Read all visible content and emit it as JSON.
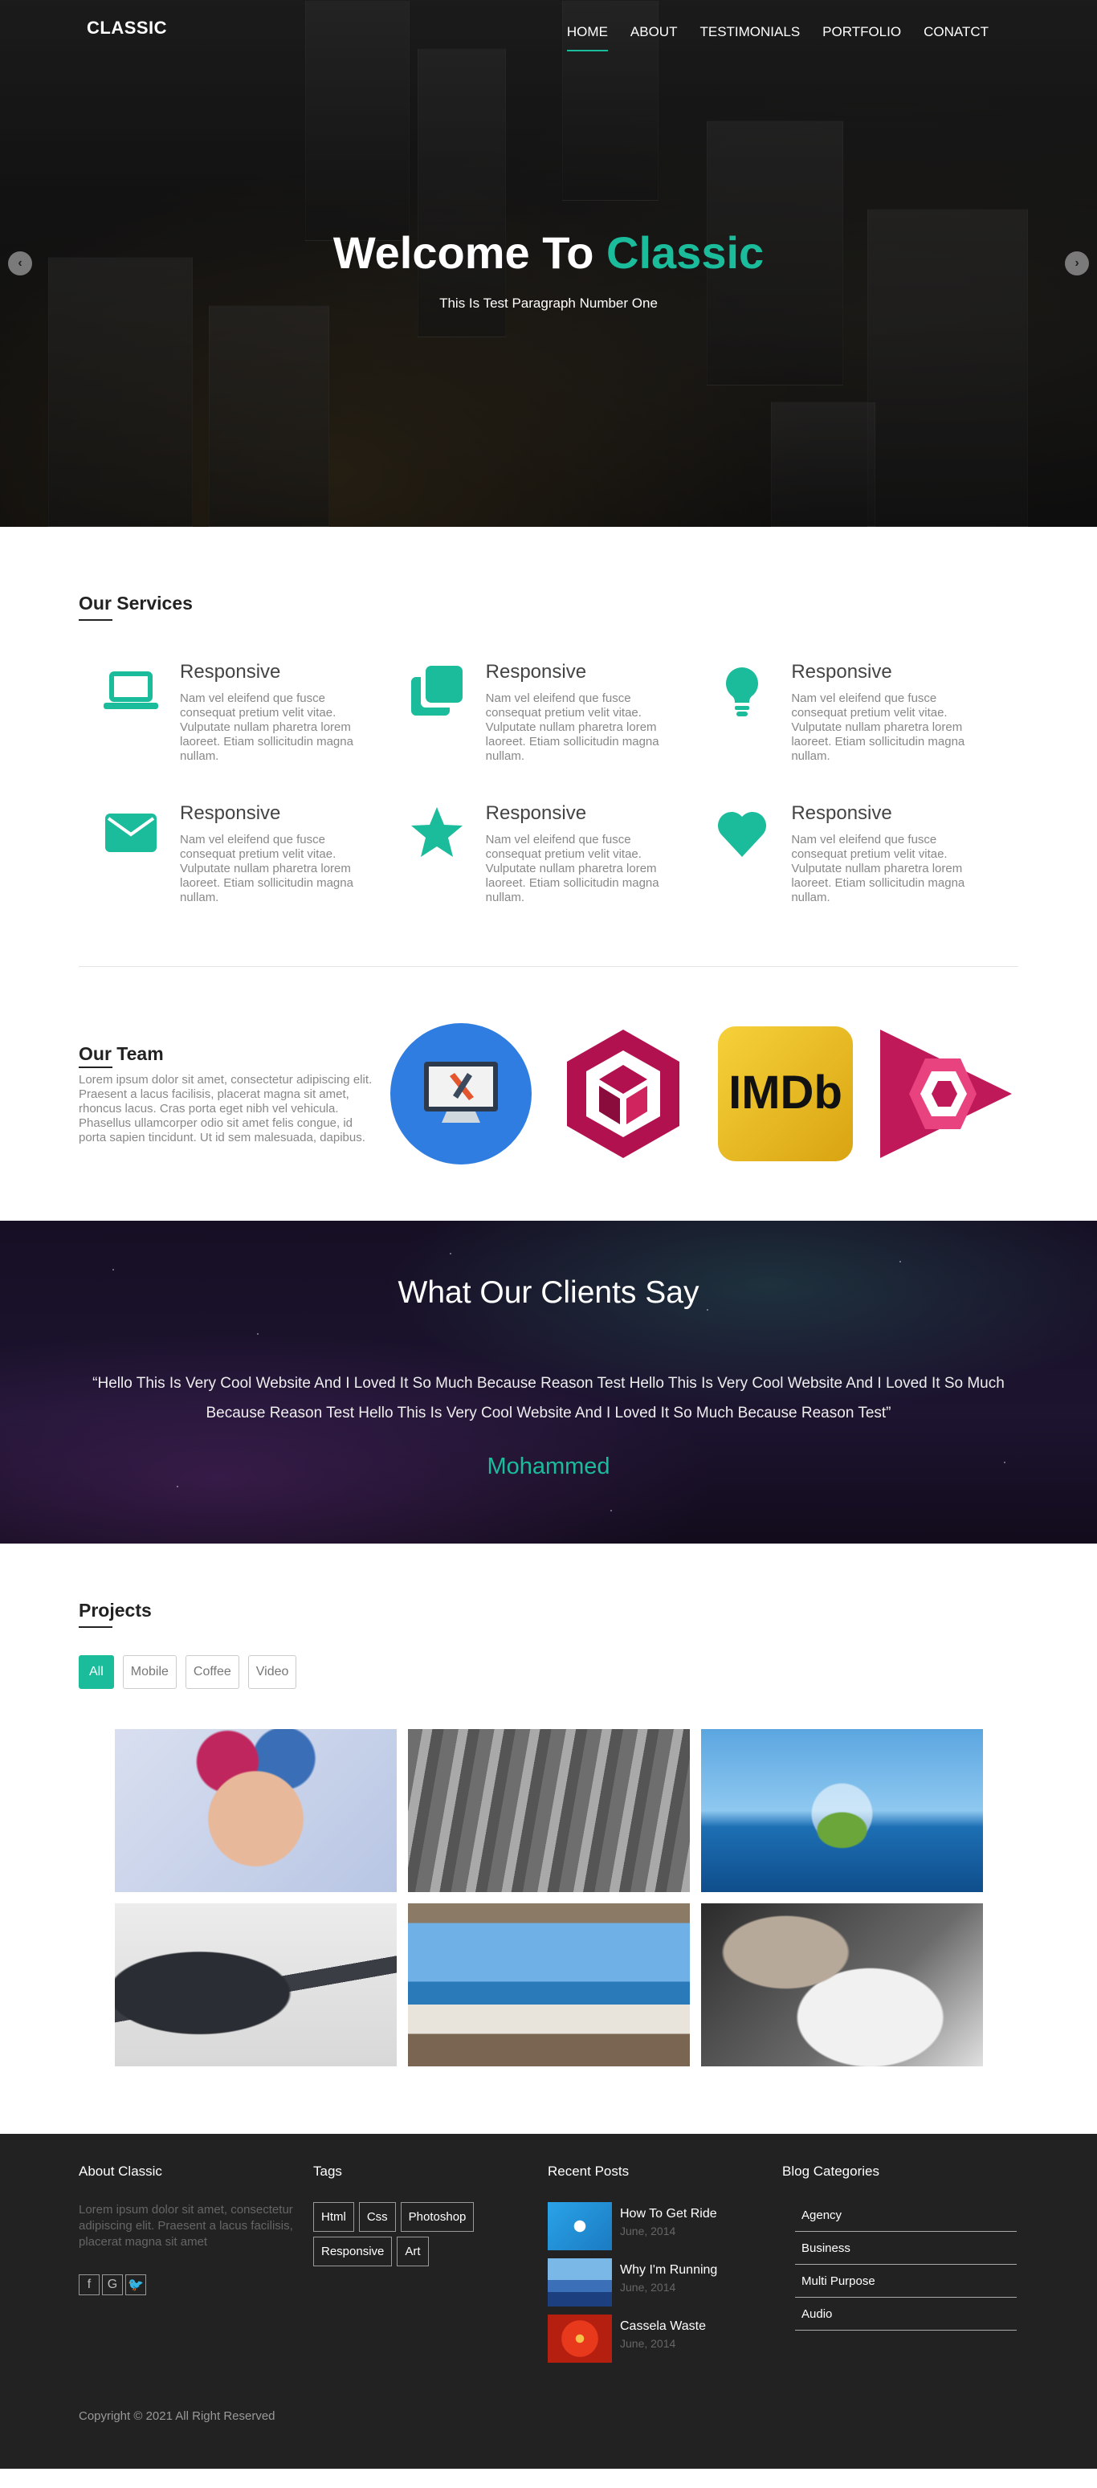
{
  "header": {
    "logo": "CLASSIC",
    "nav": [
      "HOME",
      "ABOUT",
      "TESTIMONIALS",
      "PORTFOLIO",
      "CONATCT"
    ],
    "active_nav": "HOME"
  },
  "hero": {
    "title_prefix": "Welcome To",
    "title_accent": "Classic",
    "subtitle": "This Is Test Paragraph Number One",
    "prev_icon": "chevron-left-icon",
    "next_icon": "chevron-right-icon"
  },
  "services": {
    "heading": "Our Services",
    "items": [
      {
        "icon": "laptop-icon",
        "title": "Responsive",
        "text": "Nam vel eleifend que fusce consequat pretium velit vitae. Vulputate nullam pharetra lorem laoreet. Etiam sollicitudin magna nullam."
      },
      {
        "icon": "clone-icon",
        "title": "Responsive",
        "text": "Nam vel eleifend que fusce consequat pretium velit vitae. Vulputate nullam pharetra lorem laoreet. Etiam sollicitudin magna nullam."
      },
      {
        "icon": "lightbulb-icon",
        "title": "Responsive",
        "text": "Nam vel eleifend que fusce consequat pretium velit vitae. Vulputate nullam pharetra lorem laoreet. Etiam sollicitudin magna nullam."
      },
      {
        "icon": "envelope-icon",
        "title": "Responsive",
        "text": "Nam vel eleifend que fusce consequat pretium velit vitae. Vulputate nullam pharetra lorem laoreet. Etiam sollicitudin magna nullam."
      },
      {
        "icon": "star-icon",
        "title": "Responsive",
        "text": "Nam vel eleifend que fusce consequat pretium velit vitae. Vulputate nullam pharetra lorem laoreet. Etiam sollicitudin magna nullam."
      },
      {
        "icon": "heart-icon",
        "title": "Responsive",
        "text": "Nam vel eleifend que fusce consequat pretium velit vitae. Vulputate nullam pharetra lorem laoreet. Etiam sollicitudin magna nullam."
      }
    ]
  },
  "team": {
    "heading": "Our Team",
    "text": "Lorem ipsum dolor sit amet, consectetur adipiscing elit. Praesent a lacus facilisis, placerat magna sit amet, rhoncus lacus. Cras porta eget nibh vel vehicula. Phasellus ullamcorper odio sit amet felis congue, id porta sapien tincidunt. Ut id sem malesuada, dapibus.",
    "logos": [
      "monitor-logo",
      "hexagon-cube-logo",
      "imdb-logo",
      "play-gem-logo"
    ],
    "imdb_text": "IMDb"
  },
  "testimonial": {
    "heading": "What Our Clients Say",
    "quote": "“Hello This Is Very Cool Website And I Loved It So Much Because Reason Test Hello This Is Very Cool Website And I Loved It So Much Because Reason Test Hello This Is Very Cool Website And I Loved It So Much Because Reason Test”",
    "author": "Mohammed"
  },
  "projects": {
    "heading": "Projects",
    "filters": [
      "All",
      "Mobile",
      "Coffee",
      "Video"
    ],
    "active_filter": "All",
    "images": [
      "painted-face-image",
      "fabric-spools-image",
      "island-dome-image",
      "bass-guitar-image",
      "ocean-bedroom-image",
      "hands-tool-image"
    ]
  },
  "footer": {
    "about_title": "About Classic",
    "about_text": "Lorem ipsum dolor sit amet, consectetur adipiscing elit. Praesent a lacus facilisis, placerat magna sit amet",
    "social": [
      "facebook-icon",
      "google-plus-icon",
      "twitter-icon"
    ],
    "tags_title": "Tags",
    "tags": [
      "Html",
      "Css",
      "Photoshop",
      "Responsive",
      "Art"
    ],
    "posts_title": "Recent Posts",
    "posts": [
      {
        "title": "How To Get Ride",
        "date": "June, 2014"
      },
      {
        "title": "Why I'm Running",
        "date": "June, 2014"
      },
      {
        "title": "Cassela Waste",
        "date": "June, 2014"
      }
    ],
    "categories_title": "Blog Categories",
    "categories": [
      "Agency",
      "Business",
      "Multi Purpose",
      "Audio"
    ],
    "copyright": "Copyright © 2021 All Right Reserved"
  },
  "colors": {
    "accent": "#1bbc9b",
    "footer_bg": "#222222",
    "text_muted": "#888888"
  }
}
